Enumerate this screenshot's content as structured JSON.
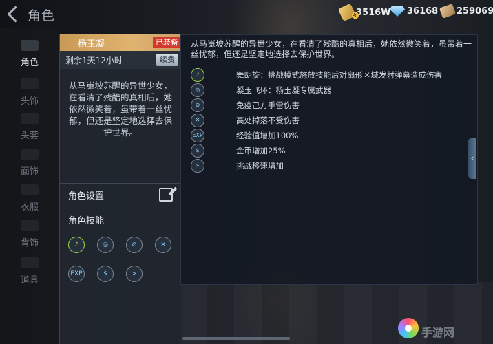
{
  "header": {
    "title": "角色",
    "currencies": [
      {
        "icon": "gold-icon",
        "value": "3516W"
      },
      {
        "icon": "diamond-icon",
        "value": "36168"
      },
      {
        "icon": "ticket-icon",
        "value": "259069"
      }
    ]
  },
  "nav": [
    {
      "label": "角色",
      "active": true
    },
    {
      "label": "头饰"
    },
    {
      "label": "头套"
    },
    {
      "label": "面饰"
    },
    {
      "label": "衣服"
    },
    {
      "label": "背饰"
    },
    {
      "label": "道具"
    }
  ],
  "card": {
    "name": "杨玉凝",
    "equipped_label": "已装备",
    "remaining": "剩余1天12小时",
    "renew_label": "续费",
    "description": "从马嵬坡苏醒的异世少女，在看清了残酷的真相后，她依然微笑着，虽带着一丝忧郁，但还是坚定地选择去保护世界。",
    "settings_label": "角色设置",
    "skills_label": "角色技能"
  },
  "skill_icons": [
    "dance-icon",
    "jade-ring-icon",
    "no-thunder-icon",
    "no-fall-icon",
    "exp-icon",
    "coin-icon",
    "speed-icon"
  ],
  "detail": {
    "description": "从马嵬坡苏醒的异世少女，在看清了残酷的真相后，她依然微笑着，虽带着一丝忧郁，但还是坚定地选择去保护世界。",
    "skills": [
      {
        "icon": "dance-icon",
        "text": "舞胡旋：挑战模式施放技能后对扇形区域发射弹幕造成伤害"
      },
      {
        "icon": "jade-ring-icon",
        "text": "凝玉飞环：杨玉凝专属武器"
      },
      {
        "icon": "no-thunder-icon",
        "text": "免疫己方手雷伤害"
      },
      {
        "icon": "no-fall-icon",
        "text": "高处掉落不受伤害"
      },
      {
        "icon": "exp-icon",
        "text": "经验值增加100%"
      },
      {
        "icon": "coin-icon",
        "text": "金币增加25%"
      },
      {
        "icon": "speed-icon",
        "text": "挑战移速增加"
      }
    ]
  },
  "watermark": "手游网"
}
